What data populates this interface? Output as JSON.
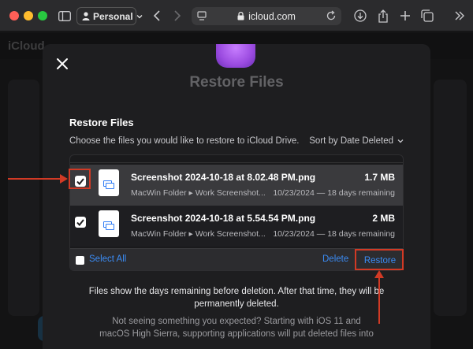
{
  "browser": {
    "profile_label": "Personal",
    "url": "icloud.com"
  },
  "background": {
    "app_logo": "iCloud"
  },
  "modal": {
    "title": "Restore Files",
    "section_title": "Restore Files",
    "description": "Choose the files you would like to restore to iCloud Drive.",
    "sort_label": "Sort by Date Deleted",
    "files": [
      {
        "name": "Screenshot 2024-10-18 at 8.02.48 PM.png",
        "size": "1.7 MB",
        "path": "MacWin Folder ▸ Work Screenshot...",
        "date": "10/23/2024 — 18 days remaining",
        "checked": true
      },
      {
        "name": "Screenshot 2024-10-18 at 5.54.54 PM.png",
        "size": "2 MB",
        "path": "MacWin Folder ▸ Work Screenshot...",
        "date": "10/23/2024 — 18 days remaining",
        "checked": true
      }
    ],
    "select_all_label": "Select All",
    "delete_label": "Delete",
    "restore_label": "Restore",
    "info_line1": "Files show the days remaining before deletion. After that time, they will be",
    "info_line2": "permanently deleted.",
    "hint_line1": "Not seeing something you expected? Starting with iOS 11 and",
    "hint_line2": "macOS High Sierra, supporting applications will put deleted files into"
  },
  "colors": {
    "accent_link": "#3b8cf5",
    "annotation": "#d23a25",
    "app_icon": "#9b4be0"
  }
}
